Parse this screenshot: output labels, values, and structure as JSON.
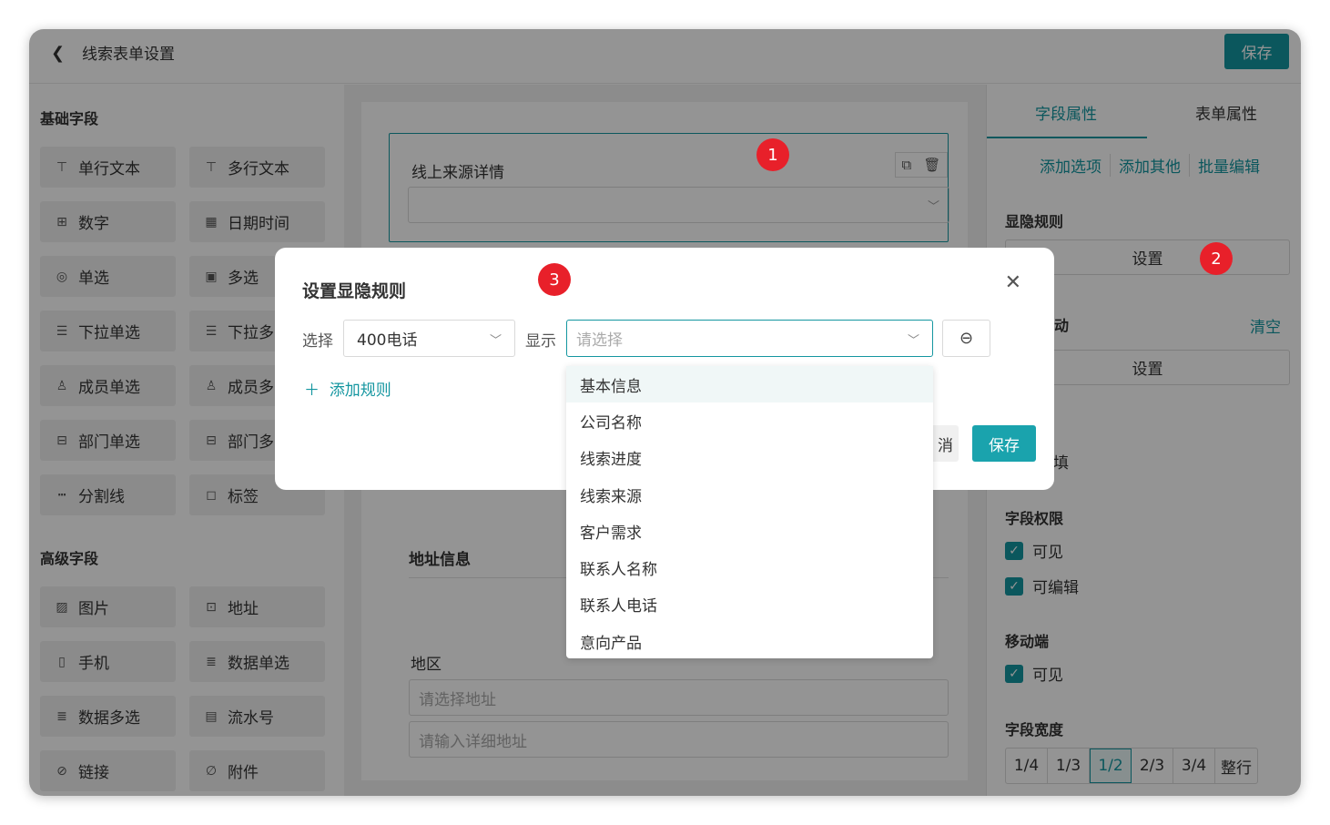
{
  "topbar": {
    "title": "线索表单设置",
    "save": "保存"
  },
  "basic": {
    "title": "基础字段",
    "items": [
      {
        "label": "单行文本",
        "icon": "⊤"
      },
      {
        "label": "多行文本",
        "icon": "⊤"
      },
      {
        "label": "数字",
        "icon": "⊞"
      },
      {
        "label": "日期时间",
        "icon": "▦"
      },
      {
        "label": "单选",
        "icon": "◎"
      },
      {
        "label": "多选",
        "icon": "▣"
      },
      {
        "label": "下拉单选",
        "icon": "☰"
      },
      {
        "label": "下拉多",
        "icon": "☰"
      },
      {
        "label": "成员单选",
        "icon": "♙"
      },
      {
        "label": "成员多",
        "icon": "♙"
      },
      {
        "label": "部门单选",
        "icon": "⊟"
      },
      {
        "label": "部门多",
        "icon": "⊟"
      },
      {
        "label": "分割线",
        "icon": "┅"
      },
      {
        "label": "标签",
        "icon": "◻"
      }
    ]
  },
  "advanced": {
    "title": "高级字段",
    "items": [
      {
        "label": "图片",
        "icon": "▨"
      },
      {
        "label": "地址",
        "icon": "⊡"
      },
      {
        "label": "手机",
        "icon": "▯"
      },
      {
        "label": "数据单选",
        "icon": "≣"
      },
      {
        "label": "数据多选",
        "icon": "≣"
      },
      {
        "label": "流水号",
        "icon": "▤"
      },
      {
        "label": "链接",
        "icon": "⊘"
      },
      {
        "label": "附件",
        "icon": "∅"
      }
    ]
  },
  "canvas": {
    "field_label": "线上来源详情",
    "address_title": "地址信息",
    "region_label": "地区",
    "region_placeholder": "请选择地址",
    "detail_placeholder": "请输入详细地址"
  },
  "panel": {
    "tab_field": "字段属性",
    "tab_form": "表单属性",
    "links": [
      "添加选项",
      "添加其他",
      "批量编辑"
    ],
    "visibility_title": "显隐规则",
    "set_btn": "设置",
    "linkage_title_partial": "动",
    "clear": "清空",
    "set_btn2": "设置",
    "required_partial": "填",
    "permission_title": "字段权限",
    "visible": "可见",
    "editable": "可编辑",
    "mobile_title": "移动端",
    "mobile_visible": "可见",
    "width_title": "字段宽度",
    "widths": [
      "1/4",
      "1/3",
      "1/2",
      "2/3",
      "3/4",
      "整行"
    ],
    "width_selected": "1/2"
  },
  "modal": {
    "title": "设置显隐规则",
    "select_label": "选择",
    "select_value": "400电话",
    "show_label": "显示",
    "show_placeholder": "请选择",
    "add_rule": "添加规则",
    "cancel_partial": "消",
    "save": "保存"
  },
  "dropdown": {
    "options": [
      "基本信息",
      "公司名称",
      "线索进度",
      "线索来源",
      "客户需求",
      "联系人名称",
      "联系人电话",
      "意向产品"
    ]
  },
  "badges": [
    "1",
    "2",
    "3"
  ],
  "colors": {
    "accent": "#1496a0",
    "badge": "#e8202a"
  }
}
